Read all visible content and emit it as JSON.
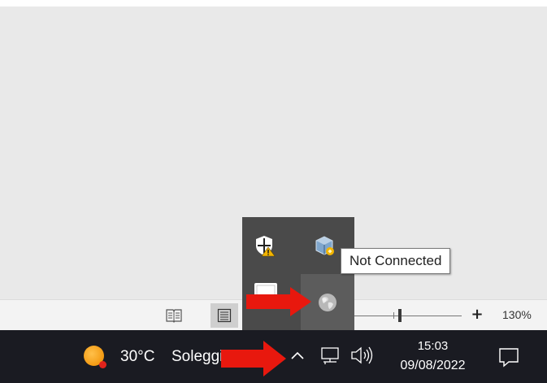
{
  "status_bar": {
    "read_mode_icon": "book-icon",
    "print_layout_icon": "page-lines-icon",
    "zoom_out_label": "–",
    "zoom_in_label": "+",
    "zoom_level": "130%"
  },
  "tray_flyout": {
    "icons": [
      "windows-security-shield-icon",
      "virtualbox-icon",
      "network-monitor-icon",
      "globe-icon"
    ],
    "tooltip": "Not Connected"
  },
  "taskbar": {
    "weather": {
      "temp": "30°C",
      "condition": "Soleggiato"
    },
    "tray_chevron": "^",
    "clock": {
      "time": "15:03",
      "date": "09/08/2022"
    }
  },
  "colors": {
    "taskbar_bg": "#1a1b22",
    "flyout_bg": "#4a4a4a",
    "arrow_red": "#e8180e",
    "weather_sun": "#f39a12"
  }
}
